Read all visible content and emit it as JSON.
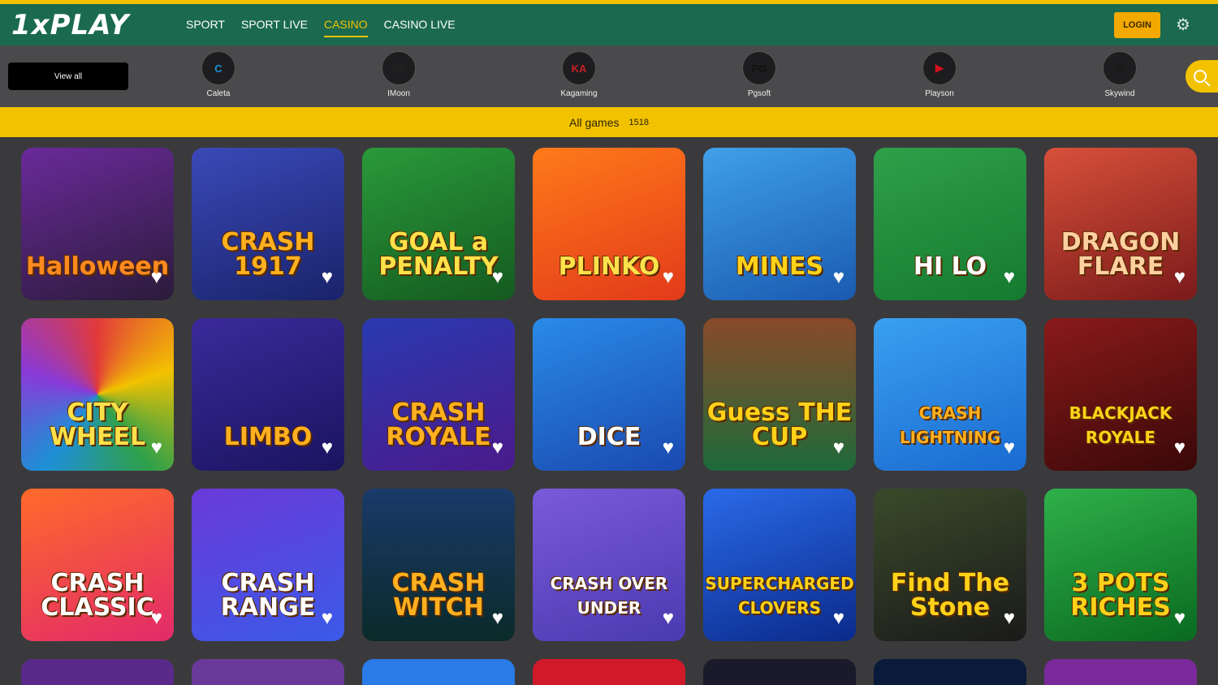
{
  "header": {
    "logo": "1xPLAY",
    "nav": [
      {
        "label": "SPORT",
        "active": false
      },
      {
        "label": "SPORT LIVE",
        "active": false
      },
      {
        "label": "CASINO",
        "active": true
      },
      {
        "label": "CASINO LIVE",
        "active": false
      }
    ],
    "login_label": "LOGIN"
  },
  "providers": {
    "view_all_label": "View all",
    "items": [
      {
        "label": "Caleta",
        "icon": "C",
        "color": "#1e8fd6"
      },
      {
        "label": "IMoon",
        "icon": "iM",
        "color": "#222222"
      },
      {
        "label": "Kagaming",
        "icon": "KA",
        "color": "#c8202a"
      },
      {
        "label": "Pgsoft",
        "icon": "PG",
        "color": "#111111"
      },
      {
        "label": "Playson",
        "icon": "▶",
        "color": "#d01020"
      },
      {
        "label": "Skywind",
        "icon": "◉",
        "color": "#1a1a1a"
      }
    ]
  },
  "all_games": {
    "label": "All games",
    "count": "1518"
  },
  "games": [
    {
      "name": "Halloween",
      "bg": "linear-gradient(160deg,#6a2a9a,#2b1b3a)",
      "color": "#ff8a20"
    },
    {
      "name": "CRASH 1917",
      "bg": "linear-gradient(160deg,#3b49b8,#19236a)",
      "color": "#ffb020"
    },
    {
      "name": "GOAL a PENALTY",
      "bg": "linear-gradient(160deg,#2a9a3a,#145a20)",
      "color": "#ffe14a"
    },
    {
      "name": "PLINKO",
      "bg": "linear-gradient(160deg,#ff7a1a,#e23a1a)",
      "color": "#ffe14a"
    },
    {
      "name": "MINES",
      "bg": "linear-gradient(160deg,#3fa0e8,#1a5ab0)",
      "color": "#ffd21a"
    },
    {
      "name": "HI LO",
      "bg": "linear-gradient(160deg,#2fa04a,#157a30)",
      "color": "#ffffff"
    },
    {
      "name": "DRAGON FLARE",
      "bg": "linear-gradient(160deg,#d8503a,#7a1a1a)",
      "color": "#ffd0a0"
    },
    {
      "name": "CITY WHEEL",
      "bg": "conic-gradient(#e23a3a,#f2c200,#2fa04a,#1e8fd6,#8a3ad8,#e23a3a)",
      "color": "#ffe14a"
    },
    {
      "name": "LIMBO",
      "bg": "linear-gradient(160deg,#3b2a9a,#1a1460)",
      "color": "#ffb020"
    },
    {
      "name": "CRASH ROYALE",
      "bg": "linear-gradient(160deg,#2a3ab0,#4a1a8a)",
      "color": "#ffb020"
    },
    {
      "name": "DICE",
      "bg": "linear-gradient(160deg,#2a8ae8,#1a4ab0)",
      "color": "#ffffff"
    },
    {
      "name": "Guess THE CUP",
      "bg": "linear-gradient(180deg,#8a4a2a,#1e6a3a)",
      "color": "#ffd21a"
    },
    {
      "name": "CRASH LIGHTNING",
      "bg": "linear-gradient(160deg,#3aa0f0,#1a6ad0)",
      "color": "#ffb020"
    },
    {
      "name": "BLACKJACK ROYALE",
      "bg": "linear-gradient(160deg,#8a1a1a,#3a0808)",
      "color": "#ffd21a"
    },
    {
      "name": "CRASH CLASSIC",
      "bg": "linear-gradient(160deg,#ff6a2a,#e22a6a)",
      "color": "#ffffff"
    },
    {
      "name": "CRASH RANGE",
      "bg": "linear-gradient(160deg,#6a3ad8,#3a5ae8)",
      "color": "#ffffff"
    },
    {
      "name": "CRASH WITCH",
      "bg": "linear-gradient(180deg,#1a3a6a,#0a2a2a)",
      "color": "#ffb020"
    },
    {
      "name": "CRASH OVER UNDER",
      "bg": "linear-gradient(160deg,#7a5ad8,#4a3ab0)",
      "color": "#ffffff"
    },
    {
      "name": "SUPERCHARGED CLOVERS",
      "bg": "linear-gradient(160deg,#2a6ae8,#0a2a8a)",
      "color": "#ffd21a"
    },
    {
      "name": "Find The Stone",
      "bg": "linear-gradient(160deg,#3a4a2a,#1a1a1a)",
      "color": "#ffd21a"
    },
    {
      "name": "3 POTS RICHES",
      "bg": "linear-gradient(160deg,#2fb04a,#0a6a20)",
      "color": "#ffd21a"
    }
  ]
}
